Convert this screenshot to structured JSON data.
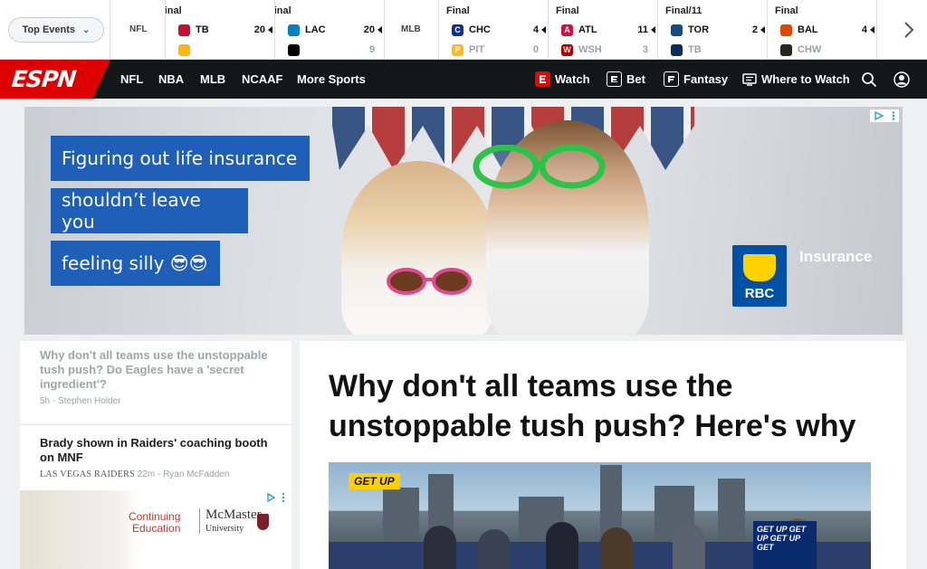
{
  "scoreboard": {
    "top_events_label": "Top Events",
    "leagues": [
      "NFL",
      "MLB"
    ],
    "games": [
      {
        "status": "Final",
        "away": {
          "abbr": "TB",
          "score": "20",
          "color": "#c8102e"
        },
        "home": {
          "abbr": "",
          "score": "",
          "color": "#ffb612"
        }
      },
      {
        "status": "Final",
        "away": {
          "abbr": "LAC",
          "score": "20",
          "color": "#0080c6"
        },
        "home": {
          "abbr": "",
          "score": "9",
          "color": "#000000"
        }
      },
      {
        "status": "Final",
        "away": {
          "abbr": "CHC",
          "score": "4",
          "color": "#0e3386"
        },
        "home": {
          "abbr": "PIT",
          "score": "0",
          "color": "#fdb827"
        }
      },
      {
        "status": "Final",
        "away": {
          "abbr": "ATL",
          "score": "11",
          "color": "#ce1141"
        },
        "home": {
          "abbr": "WSH",
          "score": "3",
          "color": "#ab0003"
        }
      },
      {
        "status": "Final/11",
        "away": {
          "abbr": "TOR",
          "score": "2",
          "color": "#134a8e"
        },
        "home": {
          "abbr": "TB",
          "score": "",
          "color": "#092c5c"
        }
      },
      {
        "status": "Final",
        "away": {
          "abbr": "BAL",
          "score": "4",
          "color": "#df4601"
        },
        "home": {
          "abbr": "CHW",
          "score": "",
          "color": "#27251f"
        }
      }
    ]
  },
  "nav": {
    "brand": "ESPN",
    "links": [
      "NFL",
      "NBA",
      "MLB",
      "NCAAF",
      "More Sports"
    ],
    "watch": "Watch",
    "bet": "Bet",
    "fantasy": "Fantasy",
    "where_to_watch": "Where to Watch",
    "colors": {
      "bar": "#151618",
      "brand": "#dd0000"
    }
  },
  "hero_ad": {
    "lines": [
      "Figuring out life insurance",
      "shouldn’t leave you",
      "feeling silly 😎😎"
    ],
    "brand": "RBC",
    "product": "Insurance",
    "accent": "#1f5fb8"
  },
  "headlines": [
    {
      "title": "Why don't all teams use the unstoppable tush push? Do Eagles have a 'secret ingredient'?",
      "age": "5h",
      "author": "Stephen Holder",
      "team": ""
    },
    {
      "title": "Brady shown in Raiders' coaching booth on MNF",
      "age": "22m",
      "author": "Ryan McFadden",
      "team": "LAS VEGAS RAIDERS"
    }
  ],
  "side_ad": {
    "line1": "Continuing",
    "line2": "Education",
    "brand": "McMaster",
    "sub": "University"
  },
  "story": {
    "title": "Why don't all teams use the unstoppable tush push? Here's why",
    "show_tag": "GET UP",
    "screen_text": "GET UP GET UP GET UP GET"
  }
}
